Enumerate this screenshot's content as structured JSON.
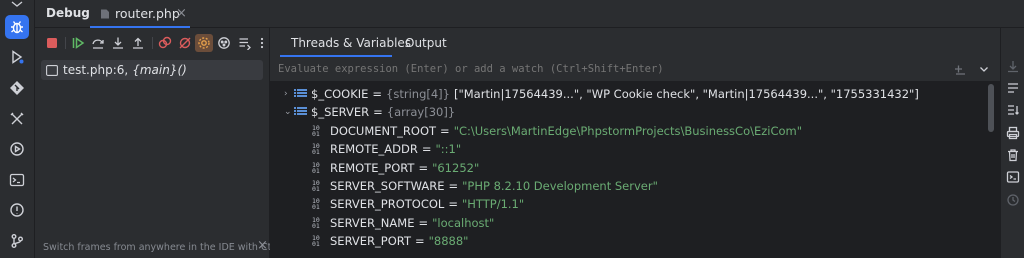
{
  "header": {
    "title": "Debug",
    "file_tab": "router.php",
    "close_glyph": "×"
  },
  "panel_tabs": [
    {
      "label": "Threads & Variables"
    },
    {
      "label": "Output"
    }
  ],
  "frames": {
    "frame_label": "test.php:6,",
    "frame_func": "{main}()",
    "hint": "Switch frames from anywhere in the IDE with Ctrl+...",
    "hint_close": "×"
  },
  "expression": {
    "placeholder": "Evaluate expression (Enter) or add a watch (Ctrl+Shift+Enter)"
  },
  "variables": [
    {
      "chevron": "›",
      "name": "$_COOKIE",
      "eq": "=",
      "type": "{string[4]}",
      "value": "[\"Martin|17564439...\", \"WP Cookie check\", \"Martin|17564439...\", \"1755331432\"]"
    },
    {
      "chevron": "⌄",
      "name": "$_SERVER",
      "eq": "=",
      "type": "{array[30]}",
      "value": ""
    }
  ],
  "server_entries": [
    {
      "name": "DOCUMENT_ROOT",
      "eq": "=",
      "value": "\"C:\\Users\\MartinEdge\\PhpstormProjects\\BusinessCo\\EziCom\""
    },
    {
      "name": "REMOTE_ADDR",
      "eq": "=",
      "value": "\"::1\""
    },
    {
      "name": "REMOTE_PORT",
      "eq": "=",
      "value": "\"61252\""
    },
    {
      "name": "SERVER_SOFTWARE",
      "eq": "=",
      "value": "\"PHP 8.2.10 Development Server\""
    },
    {
      "name": "SERVER_PROTOCOL",
      "eq": "=",
      "value": "\"HTTP/1.1\""
    },
    {
      "name": "SERVER_NAME",
      "eq": "=",
      "value": "\"localhost\""
    },
    {
      "name": "SERVER_PORT",
      "eq": "=",
      "value": "\"8888\""
    }
  ],
  "icons": {
    "sidebar": [
      "debug-icon",
      "run-icon",
      "git-icon",
      "build-icon",
      "services-icon",
      "terminal-icon",
      "problems-icon",
      "vcs-icon"
    ],
    "toolbar": [
      "stop-icon",
      "resume-icon",
      "step-over-icon",
      "step-into-icon",
      "step-out-icon",
      "view-breakpoints-icon",
      "mute-breakpoints-icon",
      "settings-icon",
      "debug-options-icon",
      "frames-options-icon",
      "more-icon"
    ],
    "right": [
      "reset-icon",
      "restore-icon",
      "sort-icon",
      "print-icon",
      "delete-icon",
      "terminal-icon",
      "history-icon"
    ]
  },
  "colors": {
    "accent": "#3574f0",
    "string": "#6aab73",
    "background": "#1e1f22",
    "panel": "#2b2d30",
    "highlight": "#3574f0"
  }
}
